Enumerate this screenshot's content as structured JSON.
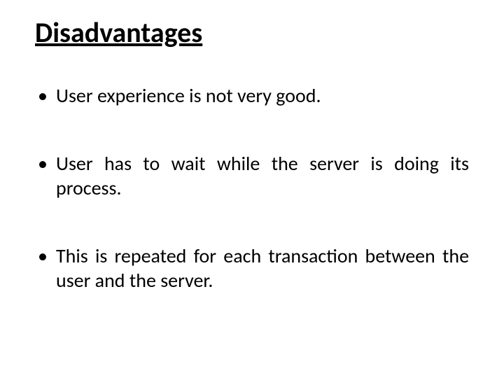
{
  "title": "Disadvantages",
  "bullets": [
    "User experience is not very good.",
    "User has to wait while the server is doing its process.",
    "This is repeated for each transaction between the user and the server."
  ]
}
